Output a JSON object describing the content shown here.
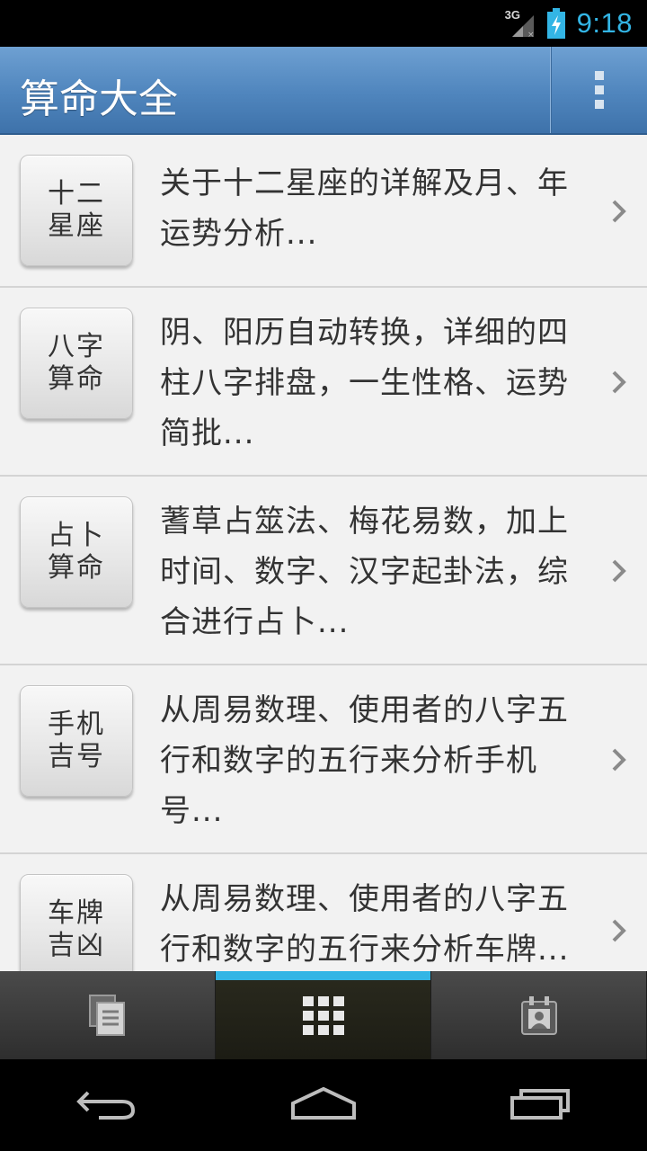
{
  "status_bar": {
    "network": "3G",
    "time": "9:18",
    "icons": [
      "signal-icon",
      "battery-charging-icon"
    ]
  },
  "action_bar": {
    "title": "算命大全",
    "overflow_icon": "overflow-menu-icon"
  },
  "list": {
    "items": [
      {
        "icon_line1": "十二",
        "icon_line2": "星座",
        "desc_lines": [
          "关于十二星座的详解及月、年",
          "运势分析..."
        ]
      },
      {
        "icon_line1": "八字",
        "icon_line2": "算命",
        "desc_lines": [
          "阴、阳历自动转换，详细的四",
          "柱八字排盘，一生性格、运势",
          "简批..."
        ]
      },
      {
        "icon_line1": "占卜",
        "icon_line2": "算命",
        "desc_lines": [
          "蓍草占筮法、梅花易数，加上",
          "时间、数字、汉字起卦法，综",
          "合进行占卜..."
        ]
      },
      {
        "icon_line1": "手机",
        "icon_line2": "吉号",
        "desc_lines": [
          "从周易数理、使用者的八字五",
          "行和数字的五行来分析手机",
          "号..."
        ]
      },
      {
        "icon_line1": "车牌",
        "icon_line2": "吉凶",
        "desc_lines": [
          "从周易数理、使用者的八字五",
          "行和数字的五行来分析车牌..."
        ]
      }
    ]
  },
  "tab_bar": {
    "tabs": [
      {
        "icon": "documents-icon",
        "selected": false
      },
      {
        "icon": "grid-icon",
        "selected": true
      },
      {
        "icon": "calendar-contact-icon",
        "selected": false
      }
    ]
  },
  "nav_bar": {
    "icons": [
      "back-icon",
      "home-icon",
      "recents-icon"
    ]
  },
  "colors": {
    "accent": "#33b5e5",
    "action_bar": "#4f85bd",
    "list_bg": "#f2f2f2"
  }
}
